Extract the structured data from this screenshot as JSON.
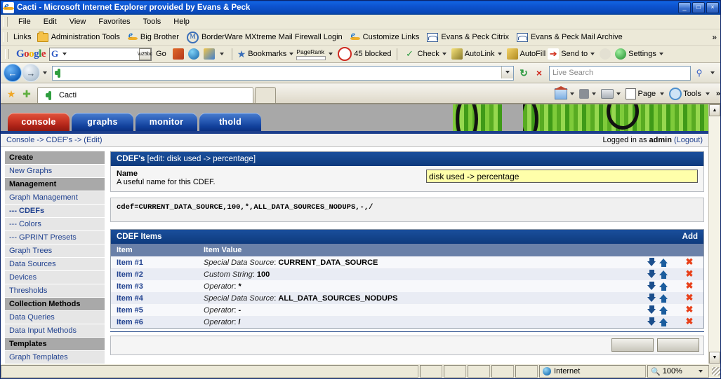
{
  "window": {
    "title": "Cacti - Microsoft Internet Explorer provided by Evans & Peck",
    "title_icon": "ie-icon",
    "minimize_label": "_",
    "maximize_label": "□",
    "close_label": "×"
  },
  "menu": {
    "items": [
      "File",
      "Edit",
      "View",
      "Favorites",
      "Tools",
      "Help"
    ]
  },
  "links_bar": {
    "label": "Links",
    "overflow": "»",
    "items": [
      {
        "label": "Administration Tools",
        "icon": "folder-icon"
      },
      {
        "label": "Big Brother",
        "icon": "ie-icon"
      },
      {
        "label": "BorderWare MXtreme Mail Firewall Login",
        "icon": "m-icon"
      },
      {
        "label": "Customize Links",
        "icon": "ie-icon"
      },
      {
        "label": "Evans & Peck Citrix",
        "icon": "window-icon"
      },
      {
        "label": "Evans & Peck Mail Archive",
        "icon": "window-icon"
      }
    ]
  },
  "google_bar": {
    "logo": "Google",
    "search_value": "",
    "search_prefix": "G",
    "go_label": "Go",
    "blocked_label": "45 blocked",
    "check_label": "Check",
    "autolink_label": "AutoLink",
    "autofill_label": "AutoFill",
    "sendto_label": "Send to",
    "settings_label": "Settings",
    "bookmarks_label": "Bookmarks",
    "pagerank_label": "PageRank"
  },
  "address_bar": {
    "back_glyph": "←",
    "forward_glyph": "→",
    "url_value": "",
    "url_icon": "cactus-icon",
    "refresh_glyph": "↻",
    "stop_glyph": "×",
    "search_placeholder": "Live Search",
    "search_value": "",
    "search_glyph": "⚲"
  },
  "browser_tabs": {
    "tabs": [
      {
        "label": "Cacti",
        "icon": "cactus-icon"
      }
    ],
    "command_bar": {
      "home_label": "",
      "feeds_label": "",
      "print_label": "",
      "page_label": "Page",
      "tools_label": "Tools",
      "overflow": "»"
    }
  },
  "cacti": {
    "tabs": [
      {
        "label": "console",
        "active": true
      },
      {
        "label": "graphs",
        "active": false
      },
      {
        "label": "monitor",
        "active": false
      },
      {
        "label": "thold",
        "active": false
      }
    ],
    "breadcrumb": "Console -> CDEF's -> (Edit)",
    "login_prefix": "Logged in as",
    "login_user": "admin",
    "logout_label": "(Logout)",
    "sidebar": [
      {
        "type": "header",
        "label": "Create"
      },
      {
        "type": "item",
        "label": "New Graphs"
      },
      {
        "type": "header",
        "label": "Management"
      },
      {
        "type": "item",
        "label": "Graph Management"
      },
      {
        "type": "sub",
        "label": "--- CDEFs",
        "current": true
      },
      {
        "type": "sub",
        "label": "--- Colors"
      },
      {
        "type": "sub",
        "label": "--- GPRINT Presets"
      },
      {
        "type": "item",
        "label": "Graph Trees"
      },
      {
        "type": "item",
        "label": "Data Sources"
      },
      {
        "type": "item",
        "label": "Devices"
      },
      {
        "type": "item",
        "label": "Thresholds"
      },
      {
        "type": "header",
        "label": "Collection Methods"
      },
      {
        "type": "item",
        "label": "Data Queries"
      },
      {
        "type": "item",
        "label": "Data Input Methods"
      },
      {
        "type": "header",
        "label": "Templates"
      },
      {
        "type": "item",
        "label": "Graph Templates"
      }
    ],
    "panel": {
      "title_bold": "CDEF's",
      "title_rest": "[edit: disk used -> percentage]",
      "name_label": "Name",
      "name_hint": "A useful name for this CDEF.",
      "name_value": "disk used -> percentage",
      "formula": "cdef=CURRENT_DATA_SOURCE,100,*,ALL_DATA_SOURCES_NODUPS,-,/"
    },
    "items_panel": {
      "title": "CDEF Items",
      "add_label": "Add",
      "columns": [
        "Item",
        "Item Value"
      ],
      "rows": [
        {
          "item": "Item #1",
          "kind": "Special Data Source",
          "value": "CURRENT_DATA_SOURCE"
        },
        {
          "item": "Item #2",
          "kind": "Custom String",
          "value": "100"
        },
        {
          "item": "Item #3",
          "kind": "Operator",
          "value": "*"
        },
        {
          "item": "Item #4",
          "kind": "Special Data Source",
          "value": "ALL_DATA_SOURCES_NODUPS"
        },
        {
          "item": "Item #5",
          "kind": "Operator",
          "value": "-"
        },
        {
          "item": "Item #6",
          "kind": "Operator",
          "value": "/"
        }
      ],
      "move_down_icon": "arrow-down-icon",
      "move_up_icon": "arrow-up-icon",
      "delete_icon": "delete-x-icon"
    }
  },
  "status_bar": {
    "message": "",
    "zone_label": "Internet",
    "zone_icon": "globe-icon",
    "zoom_label": "100%",
    "zoom_icon": "magnifier-icon"
  }
}
